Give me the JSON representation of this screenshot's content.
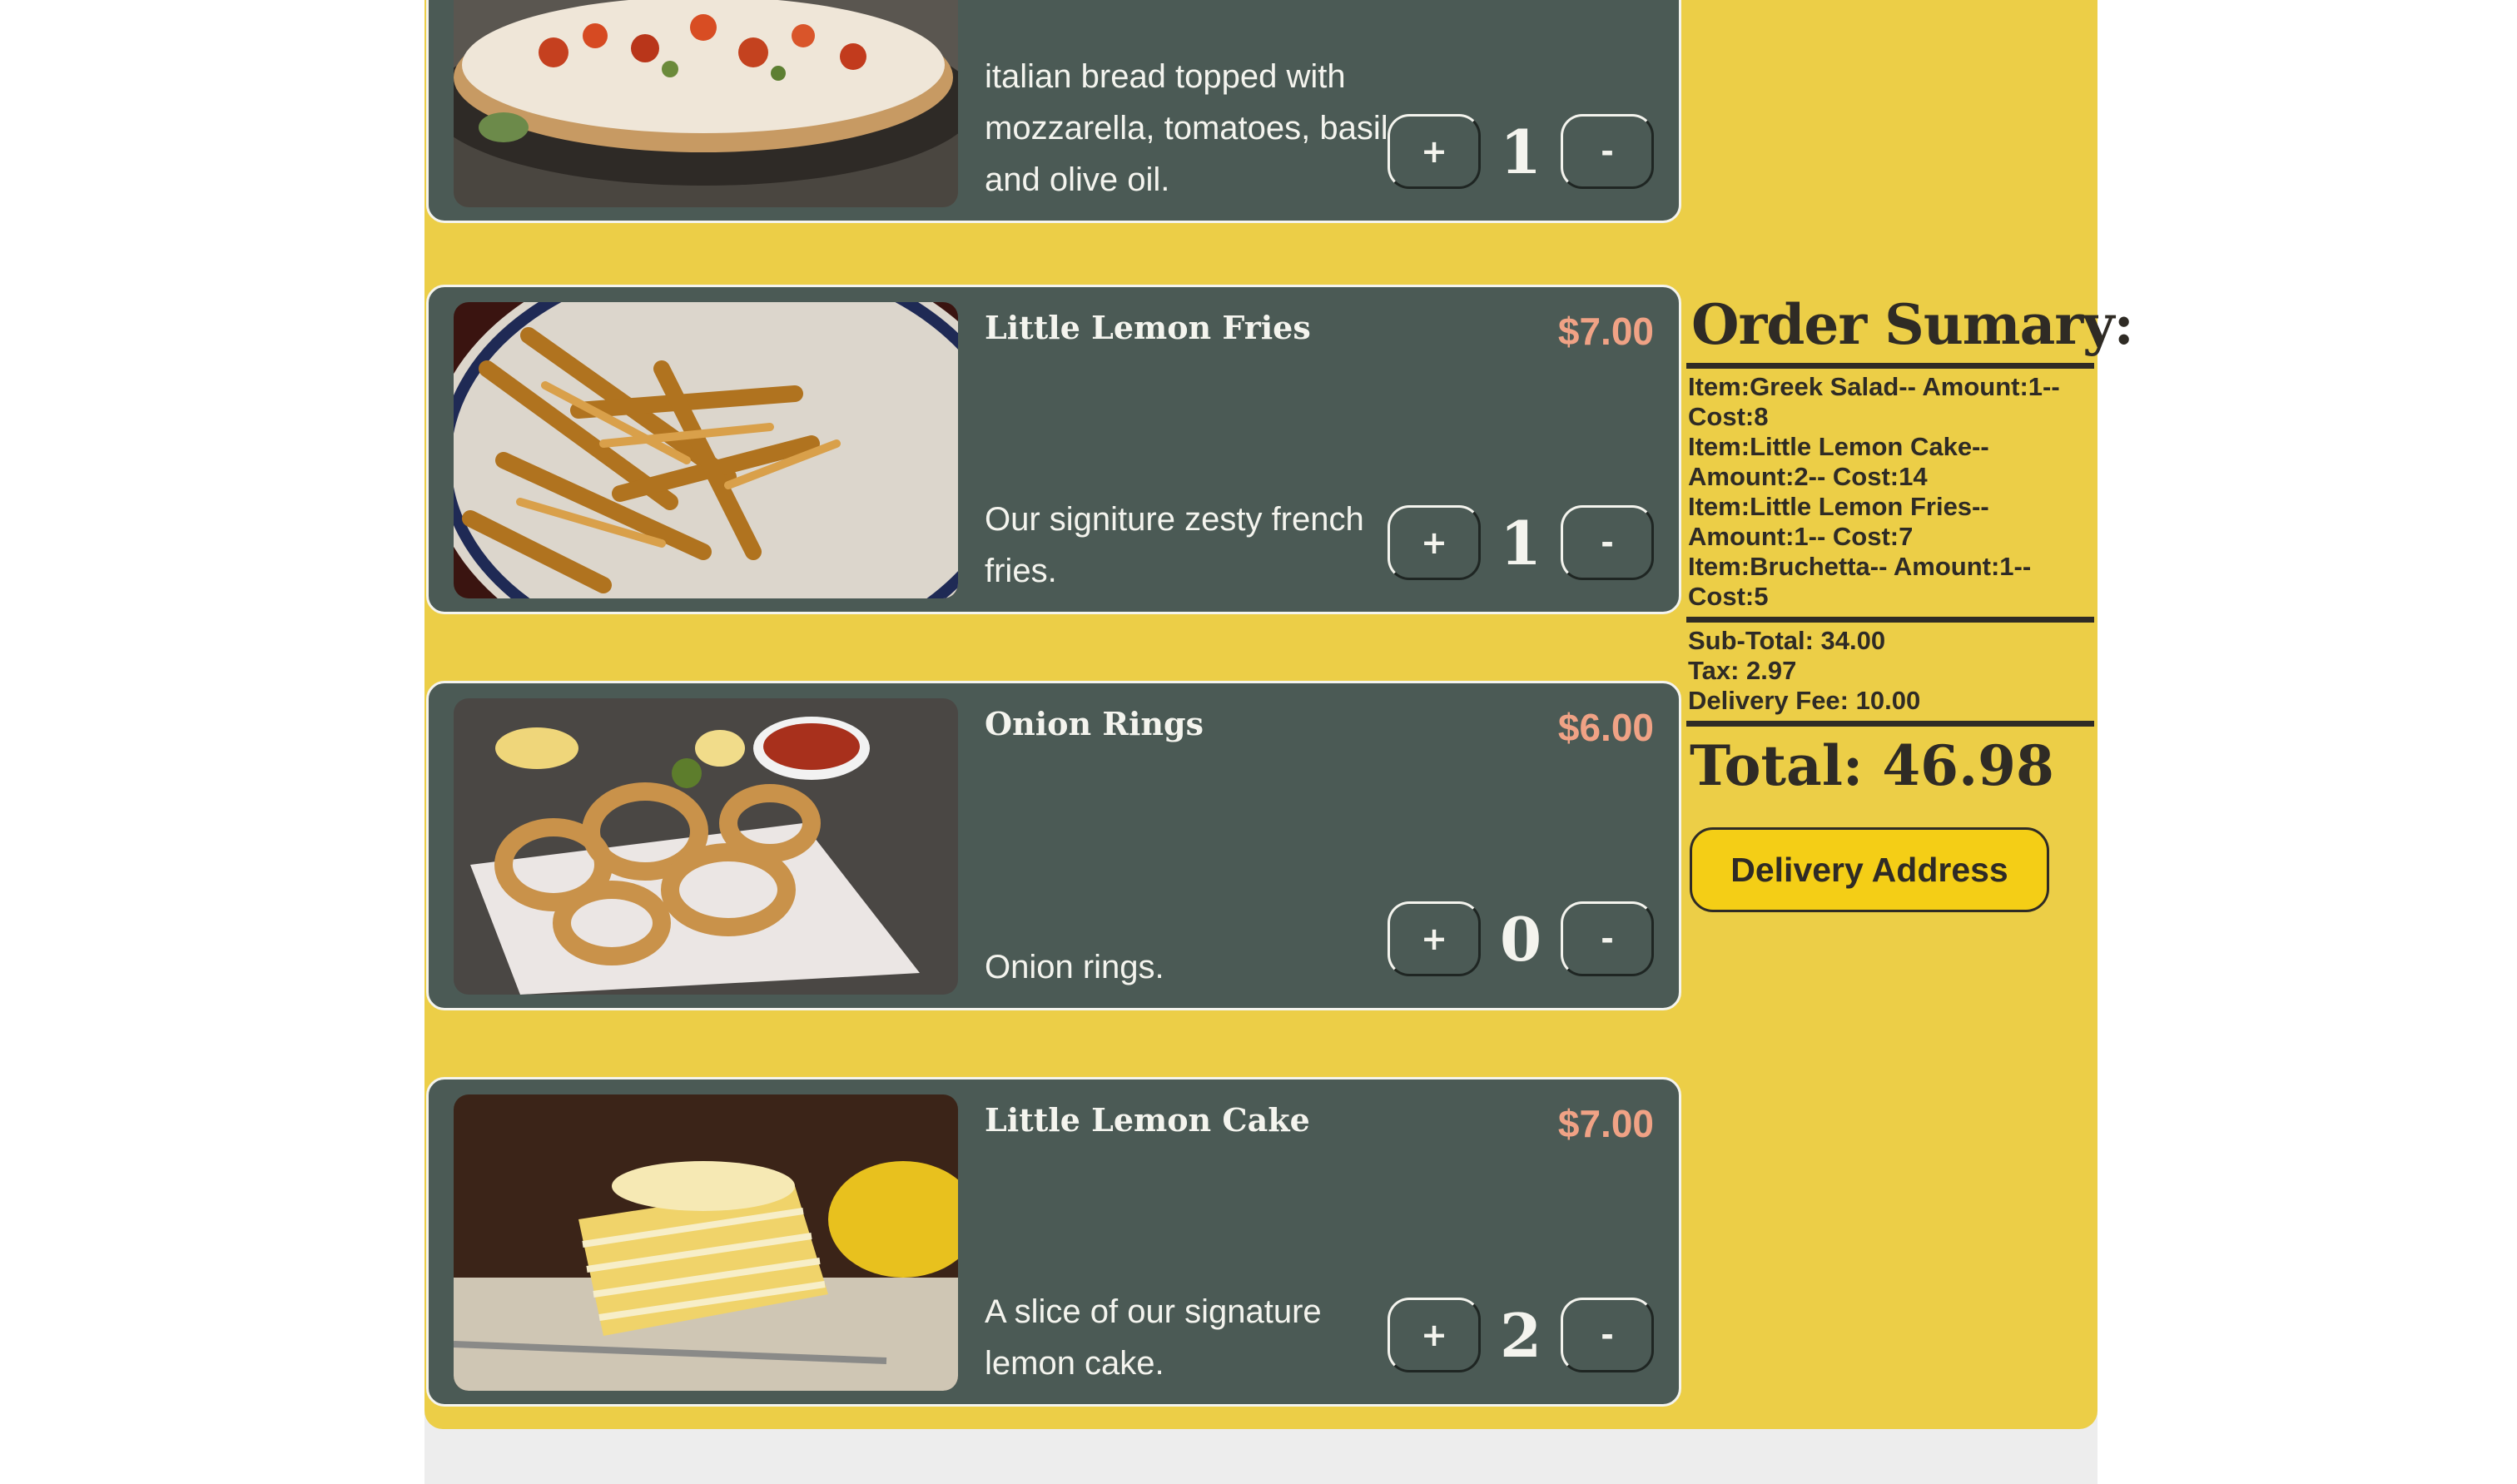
{
  "colors": {
    "page_background": "#ffffff",
    "menu_background": "#ecce47",
    "card_background": "#4b5a55",
    "card_text": "#f4f4ee",
    "price_text": "#f0a285",
    "summary_text": "#2f2b25",
    "delivery_button": "#f4ce16"
  },
  "menu": {
    "items": [
      {
        "image": "bruschetta-image",
        "name": "",
        "price": "",
        "description": "italian bread topped with mozzarella, tomatoes, basil and olive oil.",
        "quantity": "1",
        "plus_label": "+",
        "minus_label": "-"
      },
      {
        "image": "fries-image",
        "name": "Little Lemon Fries",
        "price": "$7.00",
        "description": "Our signiture zesty french fries.",
        "quantity": "1",
        "plus_label": "+",
        "minus_label": "-"
      },
      {
        "image": "onion-rings-image",
        "name": "Onion Rings",
        "price": "$6.00",
        "description": "Onion rings.",
        "quantity": "0",
        "plus_label": "+",
        "minus_label": "-"
      },
      {
        "image": "lemon-cake-image",
        "name": "Little Lemon Cake",
        "price": "$7.00",
        "description": "A slice of our signature lemon cake.",
        "quantity": "2",
        "plus_label": "+",
        "minus_label": "-"
      }
    ]
  },
  "summary": {
    "title": "Order Sumary:",
    "lines": [
      "Item:Greek Salad-- Amount:1-- Cost:8",
      "Item:Little Lemon Cake-- Amount:2-- Cost:14",
      "Item:Little Lemon Fries-- Amount:1-- Cost:7",
      "Item:Bruchetta-- Amount:1-- Cost:5"
    ],
    "subtotal": "Sub-Total: 34.00",
    "tax": "Tax: 2.97",
    "delivery_fee": "Delivery Fee: 10.00",
    "total": "Total: 46.98"
  },
  "delivery_button_label": "Delivery Address"
}
